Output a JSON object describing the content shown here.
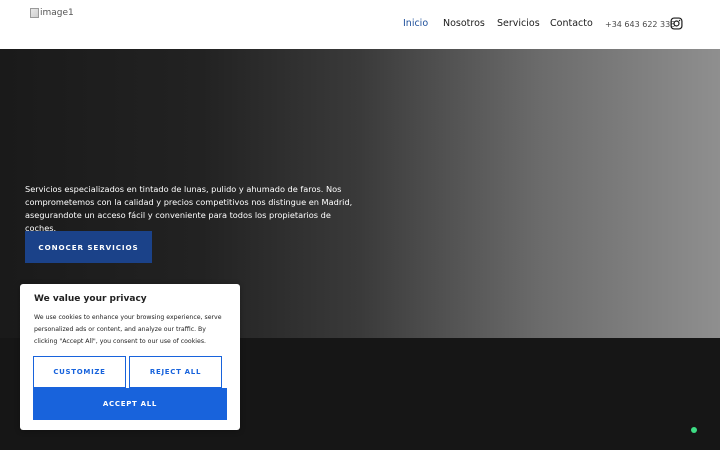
{
  "header": {
    "logo_alt": "image1",
    "nav": [
      {
        "label": "Inicio",
        "active": true
      },
      {
        "label": "Nosotros",
        "active": false
      },
      {
        "label": "Servicios",
        "active": false
      },
      {
        "label": "Contacto",
        "active": false
      }
    ],
    "phone": "+34 643 622 338",
    "social_icon": "instagram-icon"
  },
  "hero": {
    "description": "Servicios especializados en tintado de lunas, pulido y ahumado de faros. Nos comprometemos con la calidad y precios competitivos nos distingue en Madrid, asegurandote un acceso fácil y conveniente para todos los propietarios de coches.",
    "cta_label": "CONOCER SERVICIOS"
  },
  "cookie_banner": {
    "title": "We value your privacy",
    "body": "We use cookies to enhance your browsing experience, serve personalized ads or content, and analyze our traffic. By clicking \"Accept All\", you consent to our use of cookies.",
    "customize_label": "CUSTOMIZE",
    "reject_label": "REJECT ALL",
    "accept_label": "ACCEPT ALL"
  },
  "colors": {
    "nav_active": "#1d4f9a",
    "cta_bg": "#1b4289",
    "cookie_accent": "#1863dc",
    "status_dot": "#3ddc84"
  }
}
